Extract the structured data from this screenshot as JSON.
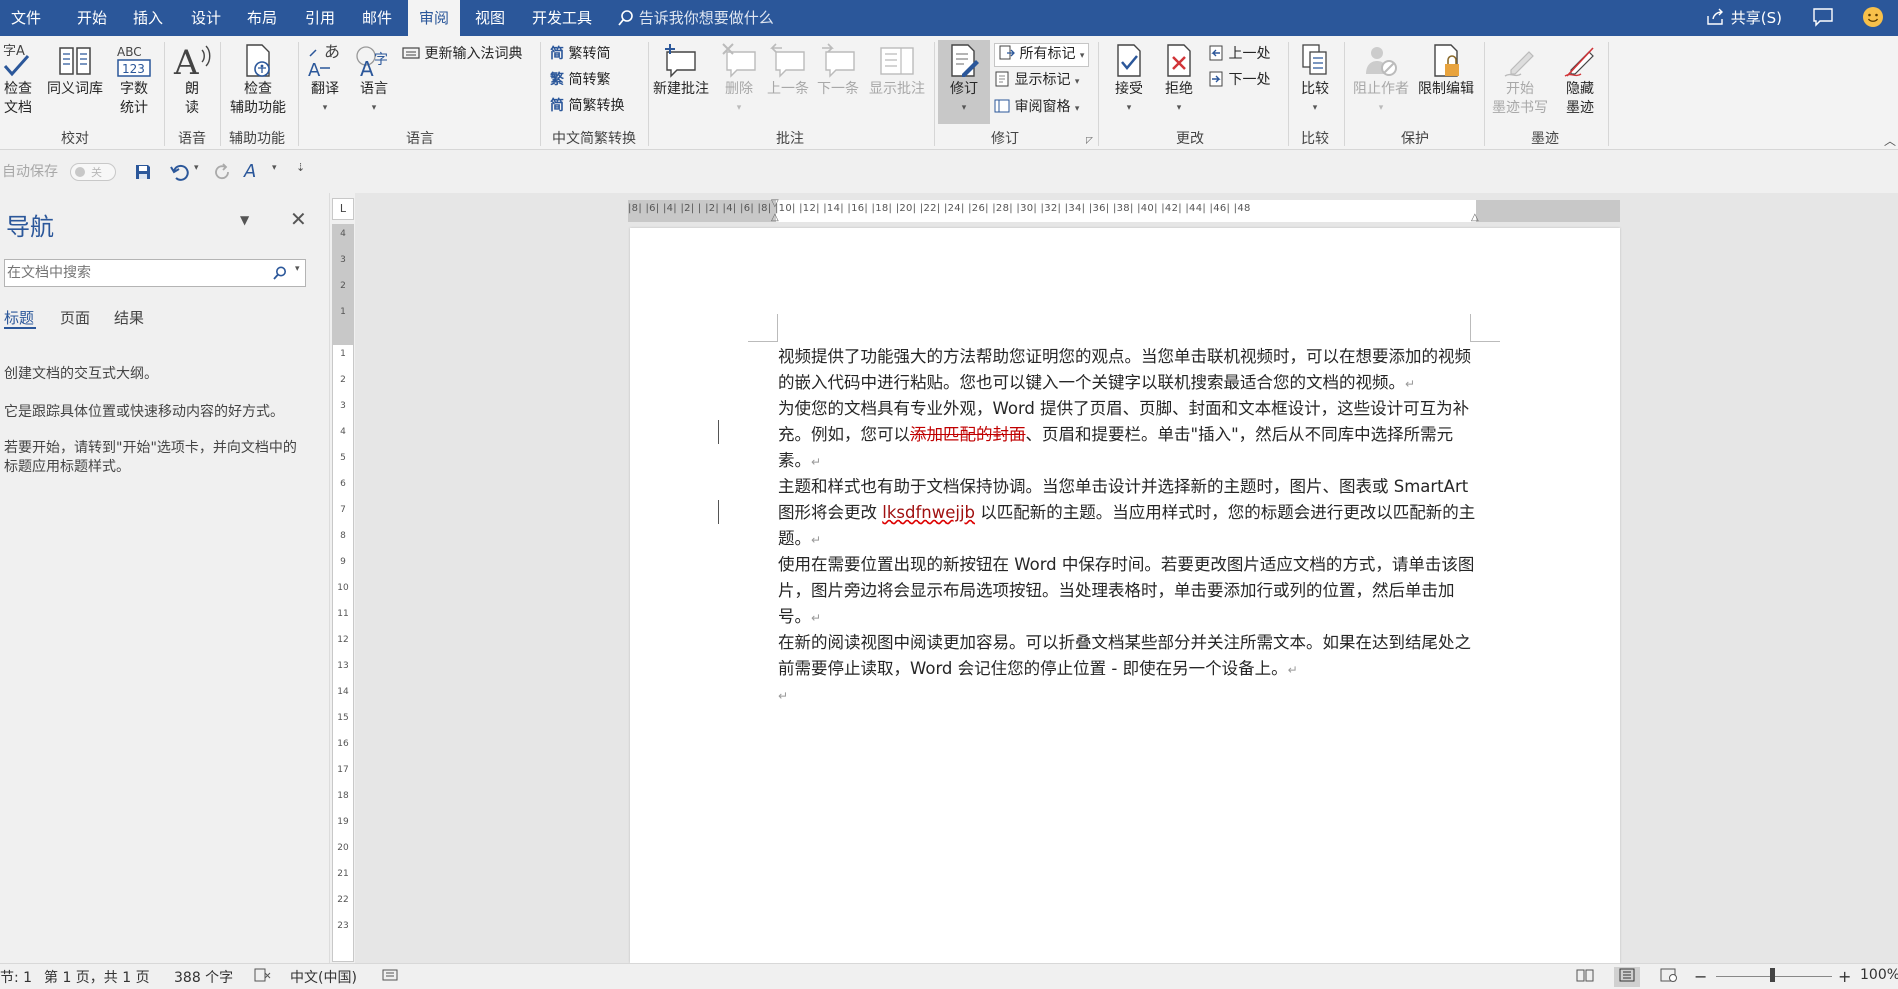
{
  "menubar": {
    "tabs": [
      "文件",
      "开始",
      "插入",
      "设计",
      "布局",
      "引用",
      "邮件",
      "审阅",
      "视图",
      "开发工具"
    ],
    "active_tab": "审阅",
    "tell_me": "告诉我你想要做什么",
    "share": "共享(S)"
  },
  "ribbon": {
    "proofing": {
      "check": "检查\n文档",
      "thesaurus": "同义词库",
      "wordcount": "字数\n统计",
      "label": "校对"
    },
    "speech": {
      "read": "朗\n读",
      "label": "语音"
    },
    "accessibility": {
      "check": "检查\n辅助功能",
      "label": "辅助功能"
    },
    "language": {
      "translate": "翻译",
      "language": "语言",
      "update_ime": "更新输入法词典",
      "label": "语言"
    },
    "chinese": {
      "t2s": "繁转简",
      "s2t": "简转繁",
      "convert": "简繁转换",
      "label": "中文简繁转换"
    },
    "comments": {
      "new": "新建批注",
      "delete": "删除",
      "prev": "上一条",
      "next": "下一条",
      "show": "显示批注",
      "label": "批注"
    },
    "tracking": {
      "track": "修订",
      "all_markup": "所有标记",
      "show_markup": "显示标记",
      "review_pane": "审阅窗格",
      "label": "修订"
    },
    "changes": {
      "accept": "接受",
      "reject": "拒绝",
      "prev": "上一处",
      "next": "下一处",
      "label": "更改"
    },
    "compare": {
      "compare": "比较",
      "label": "比较"
    },
    "protect": {
      "block": "阻止作者",
      "restrict": "限制编辑",
      "label": "保护"
    },
    "ink": {
      "start": "开始\n墨迹书写",
      "hide": "隐藏\n墨迹",
      "label": "墨迹"
    }
  },
  "qat": {
    "autosave": "自动保存",
    "autosave_state": "关"
  },
  "nav": {
    "title": "导航",
    "search_placeholder": "在文档中搜索",
    "tabs": [
      "标题",
      "页面",
      "结果"
    ],
    "text1": "创建文档的交互式大纲。",
    "text2": "它是跟踪具体位置或快速移动内容的好方式。",
    "text3": "若要开始，请转到\"开始\"选项卡，并向文档中的标题应用标题样式。"
  },
  "hruler_ticks": "|8| |6| |4| |2| | |2| |4| |6| |8| |10| |12| |14| |16| |18| |20| |22| |24| |26| |28| |30| |32| |34| |36| |38| |40| |42| |44| |46| |48",
  "document": {
    "p1": "视频提供了功能强大的方法帮助您证明您的观点。当您单击联机视频时，可以在想要添加的视频的嵌入代码中进行粘贴。您也可以键入一个关键字以联机搜索最适合您的文档的视频。",
    "p2a": "为使您的文档具有专业外观，Word 提供了页眉、页脚、封面和文本框设计，这些设计可互为补充。例如，您可以",
    "p2del": "添加匹配的封面",
    "p2b": "、页眉和提要栏。单击\"插入\"，然后从不同库中选择所需元素。",
    "p3a": "主题和样式也有助于文档保持协调。当您单击设计并选择新的主题时，图片、图表或 SmartArt 图形将会更改 ",
    "p3typo": "lksdfnwejjb",
    "p3b": " 以匹配新的主题。当应用样式时，您的标题会进行更改以匹配新的主题。",
    "p4": "使用在需要位置出现的新按钮在 Word 中保存时间。若要更改图片适应文档的方式，请单击该图片，图片旁边将会显示布局选项按钮。当处理表格时，单击要添加行或列的位置，然后单击加号。",
    "p5": "在新的阅读视图中阅读更加容易。可以折叠文档某些部分并关注所需文本。如果在达到结尾处之前需要停止读取，Word 会记住您的停止位置 - 即使在另一个设备上。",
    "mark": "↵"
  },
  "status": {
    "section": "节: 1",
    "page": "第 1 页，共 1 页",
    "words": "388 个字",
    "lang": "中文(中国)",
    "zoom": "100%"
  },
  "colors": {
    "accent": "#2b579a",
    "deletion": "#c00000"
  }
}
